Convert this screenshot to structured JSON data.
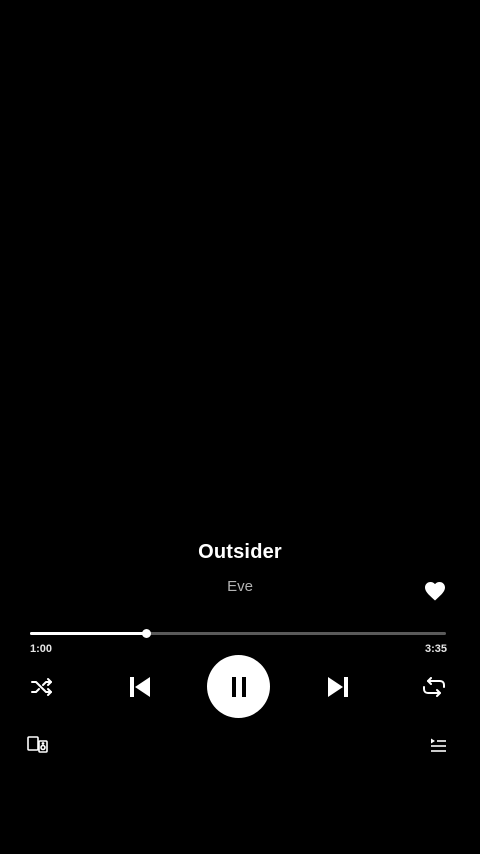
{
  "track": {
    "title": "Outsider",
    "artist": "Eve",
    "liked": true
  },
  "playback": {
    "elapsed": "1:00",
    "duration": "3:35",
    "progress_fraction": 0.279,
    "state": "playing"
  },
  "icons": {
    "like": "heart-filled-icon",
    "shuffle": "shuffle-icon",
    "previous": "skip-previous-icon",
    "play_pause": "pause-icon",
    "next": "skip-next-icon",
    "repeat": "repeat-icon",
    "devices": "devices-icon",
    "queue": "queue-icon"
  },
  "colors": {
    "background": "#000000",
    "primary_text": "#ffffff",
    "secondary_text": "#b3b3b3",
    "progress_track": "#5a5a5a",
    "progress_fill": "#ffffff"
  }
}
